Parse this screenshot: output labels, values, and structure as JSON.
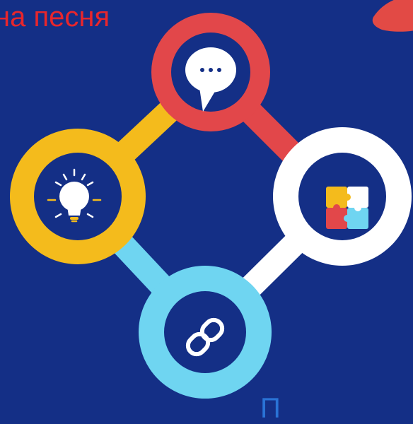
{
  "header": {
    "title": "на песня"
  },
  "footer": {
    "letter": "П"
  },
  "colors": {
    "background": "#142f86",
    "title": "#e8262c",
    "red": "#e2474a",
    "yellow": "#f4bb1c",
    "white": "#ffffff",
    "cyan": "#6fd5f1",
    "accent_blue": "#2a73d6",
    "leaf": "#e24a45"
  },
  "nodes": [
    {
      "id": "speech",
      "color": "red",
      "icon": "speech-bubble-icon"
    },
    {
      "id": "idea",
      "color": "yellow",
      "icon": "light-bulb-icon"
    },
    {
      "id": "puzzle",
      "color": "white",
      "icon": "puzzle-icon"
    },
    {
      "id": "link",
      "color": "cyan",
      "icon": "chain-link-icon"
    }
  ]
}
